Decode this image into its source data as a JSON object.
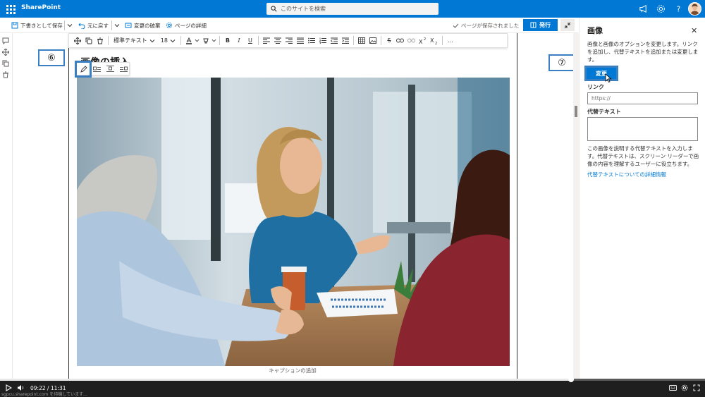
{
  "suite": {
    "app_name": "SharePoint",
    "search_placeholder": "このサイトを検索"
  },
  "commands": {
    "save_draft": "下書きとして保存",
    "undo": "元に戻す",
    "discard": "変更の破棄",
    "page_details": "ページの詳細",
    "saved_status": "ページが保存されました",
    "publish": "発行"
  },
  "format_toolbar": {
    "style": "標準テキスト",
    "font_size": "18",
    "more": "..."
  },
  "content": {
    "heading": "画像の挿入",
    "caption_placeholder": "キャプションの追加"
  },
  "callouts": {
    "step6": "⑥",
    "step7": "⑦"
  },
  "pane": {
    "title": "画像",
    "description": "画像と画像のオプションを変更します。リンクを追加し、代替テキストを追加または変更します。",
    "change_button": "変更",
    "link_label": "リンク",
    "link_placeholder": "https://",
    "alt_label": "代替テキスト",
    "alt_help": "この画像を説明する代替テキストを入力します。代替テキストは、スクリーン リーダーで画像の内容を理解するユーザーに役立ちます。",
    "alt_link": "代替テキストについての詳細情報"
  },
  "video": {
    "time": "09:22 / 11:31",
    "progress": 0.81,
    "status_url": "sgpcu.sharepoint.com を待機しています..."
  },
  "colors": {
    "accent": "#0078d4",
    "callout_border": "#3a7fc1"
  }
}
